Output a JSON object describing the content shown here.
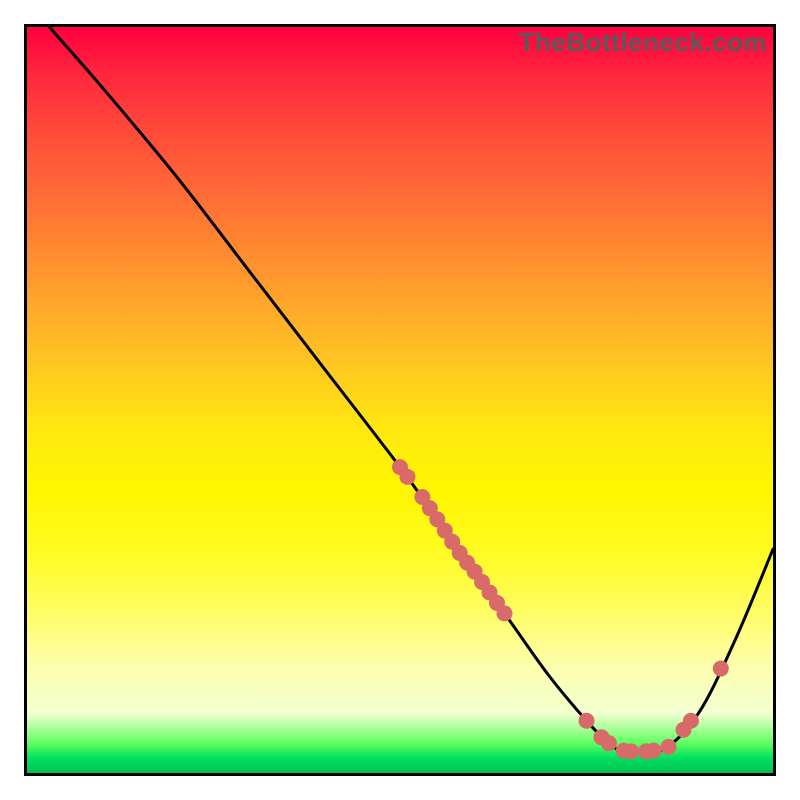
{
  "watermark": "TheBottleneck.com",
  "chart_data": {
    "type": "line",
    "title": "",
    "xlabel": "",
    "ylabel": "",
    "xlim": [
      0,
      100
    ],
    "ylim": [
      0,
      100
    ],
    "series": [
      {
        "name": "curve",
        "x": [
          3,
          10,
          20,
          30,
          40,
          50,
          55,
          60,
          65,
          70,
          75,
          78,
          80,
          85,
          90,
          95,
          100
        ],
        "y": [
          100,
          92,
          80,
          67,
          54,
          41,
          34,
          27,
          20,
          13,
          7,
          4,
          3,
          3,
          8,
          18,
          30
        ]
      }
    ],
    "markers": [
      {
        "x": 50,
        "y": 41
      },
      {
        "x": 51,
        "y": 39.7
      },
      {
        "x": 53,
        "y": 37
      },
      {
        "x": 54,
        "y": 35.5
      },
      {
        "x": 55,
        "y": 34
      },
      {
        "x": 56,
        "y": 32.5
      },
      {
        "x": 57,
        "y": 31
      },
      {
        "x": 58,
        "y": 29.5
      },
      {
        "x": 59,
        "y": 28.2
      },
      {
        "x": 60,
        "y": 27
      },
      {
        "x": 61,
        "y": 25.6
      },
      {
        "x": 62,
        "y": 24.2
      },
      {
        "x": 63,
        "y": 22.8
      },
      {
        "x": 64,
        "y": 21.4
      },
      {
        "x": 75,
        "y": 7
      },
      {
        "x": 77,
        "y": 4.8
      },
      {
        "x": 78,
        "y": 4
      },
      {
        "x": 80,
        "y": 3
      },
      {
        "x": 81,
        "y": 2.9
      },
      {
        "x": 83,
        "y": 2.9
      },
      {
        "x": 84,
        "y": 3
      },
      {
        "x": 86,
        "y": 3.5
      },
      {
        "x": 88,
        "y": 5.8
      },
      {
        "x": 89,
        "y": 7
      },
      {
        "x": 93,
        "y": 14
      }
    ],
    "colors": {
      "curve": "#000000",
      "marker": "#d96a6a"
    },
    "gradient_stops": [
      {
        "pos": 0.0,
        "color": "#ff0040"
      },
      {
        "pos": 0.46,
        "color": "#ffca20"
      },
      {
        "pos": 0.62,
        "color": "#fff600"
      },
      {
        "pos": 0.96,
        "color": "#60ff60"
      },
      {
        "pos": 1.0,
        "color": "#00c050"
      }
    ]
  }
}
